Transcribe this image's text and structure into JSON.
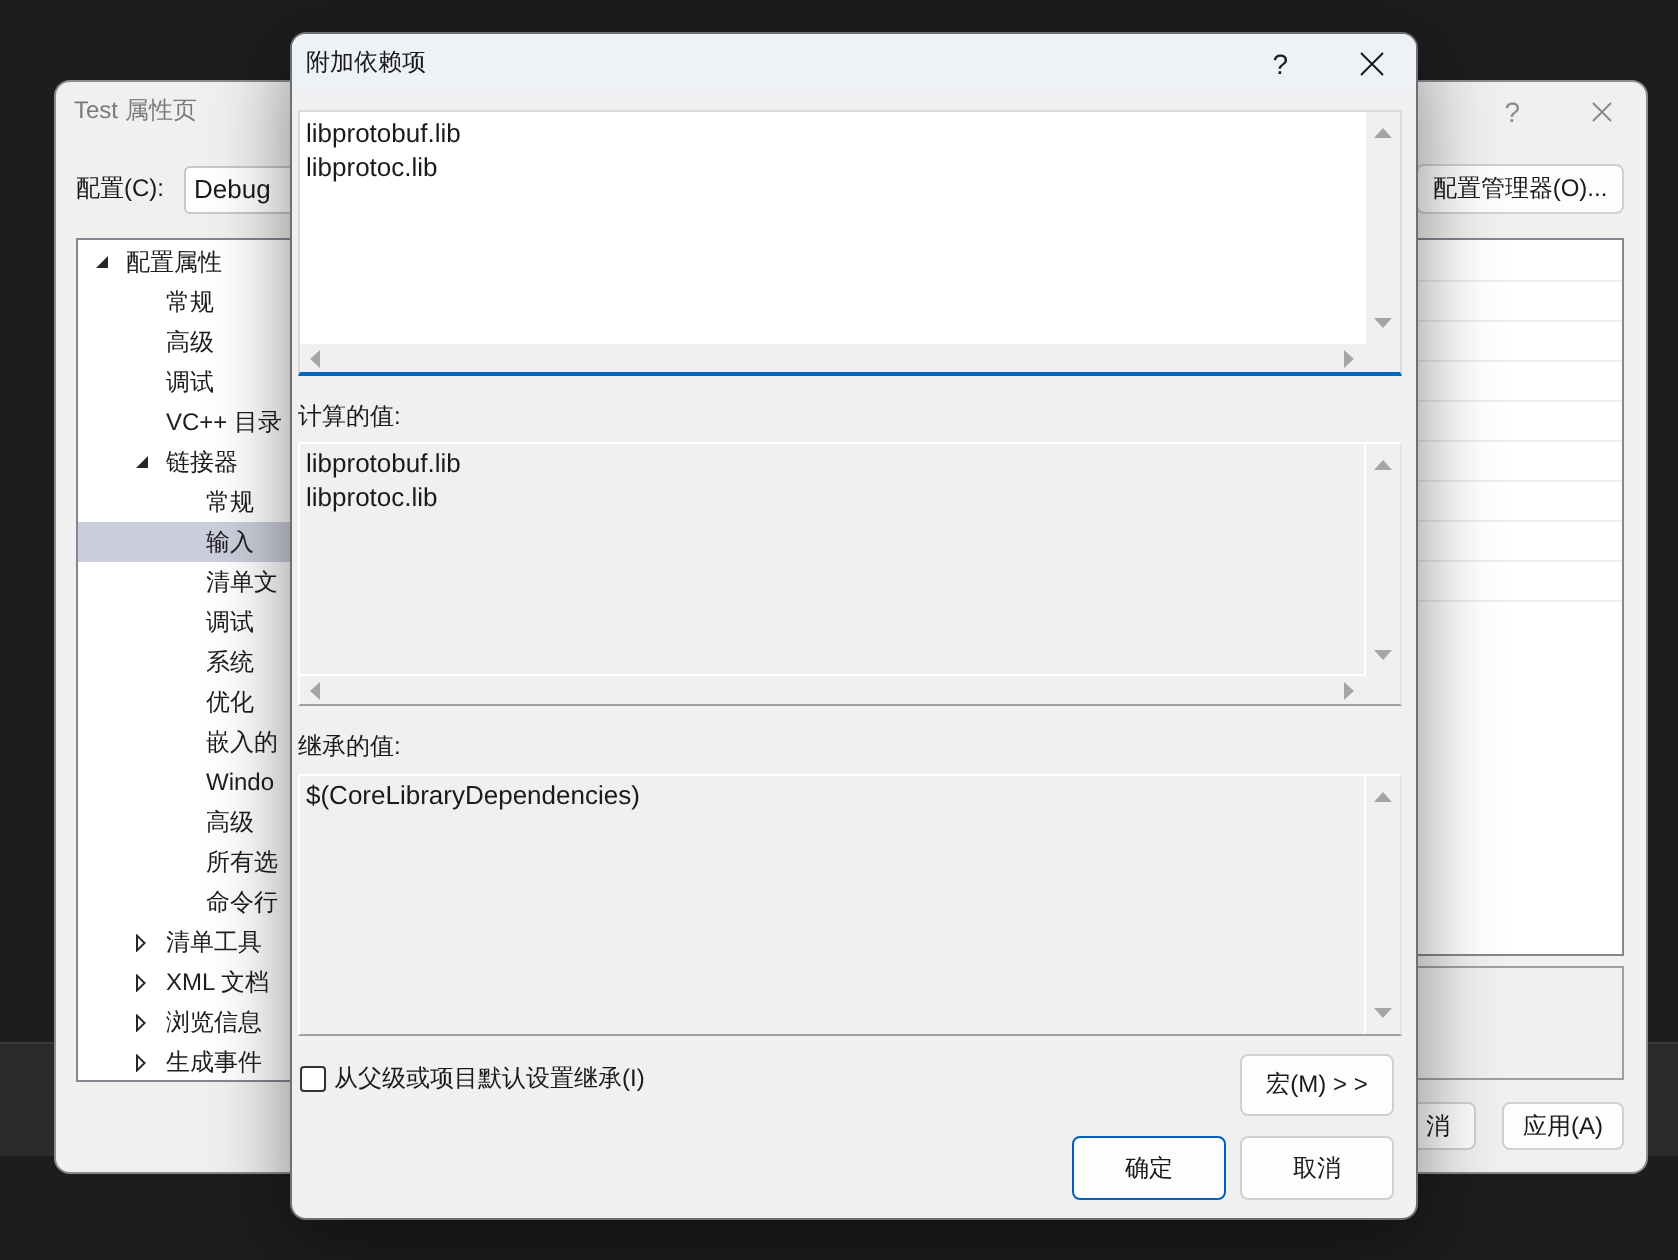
{
  "background_window": {
    "title": "Test 属性页",
    "help": "?",
    "config_label": "配置(C):",
    "config_value": "Debug",
    "config_manager_button": "配置管理器(O)...",
    "tree": [
      {
        "label": "配置属性",
        "expanded": true,
        "selected": false,
        "children": [
          {
            "label": "常规",
            "selected": false
          },
          {
            "label": "高级",
            "selected": false
          },
          {
            "label": "调试",
            "selected": false
          },
          {
            "label": "VC++ 目录",
            "selected": false
          },
          {
            "label": "链接器",
            "expanded": true,
            "selected": false,
            "children": [
              {
                "label": "常规",
                "selected": false
              },
              {
                "label": "输入",
                "selected": true
              },
              {
                "label": "清单文",
                "selected": false
              },
              {
                "label": "调试",
                "selected": false
              },
              {
                "label": "系统",
                "selected": false
              },
              {
                "label": "优化",
                "selected": false
              },
              {
                "label": "嵌入的",
                "selected": false
              },
              {
                "label": "Windo",
                "selected": false
              },
              {
                "label": "高级",
                "selected": false
              },
              {
                "label": "所有选",
                "selected": false
              },
              {
                "label": "命令行",
                "selected": false
              }
            ]
          },
          {
            "label": "清单工具",
            "expanded": false,
            "selected": false
          },
          {
            "label": "XML 文档",
            "expanded": false,
            "selected": false
          },
          {
            "label": "浏览信息",
            "expanded": false,
            "selected": false
          },
          {
            "label": "生成事件",
            "expanded": false,
            "selected": false
          }
        ]
      }
    ],
    "buttons": [
      "消",
      "应用(A)"
    ]
  },
  "dialog": {
    "title": "附加依赖项",
    "help": "?",
    "editor": {
      "lines": [
        "libprotobuf.lib",
        "libprotoc.lib"
      ],
      "focused": true
    },
    "computed": {
      "label": "计算的值:",
      "lines": [
        "libprotobuf.lib",
        "libprotoc.lib"
      ]
    },
    "inherited": {
      "label": "继承的值:",
      "lines": [
        "$(CoreLibraryDependencies)"
      ]
    },
    "inherit_checkbox": {
      "label": "从父级或项目默认设置继承(I)",
      "checked": false
    },
    "macro_button": "宏(M) > >",
    "buttons": [
      {
        "label": "确定",
        "default": true
      },
      {
        "label": "取消",
        "default": false
      }
    ]
  }
}
